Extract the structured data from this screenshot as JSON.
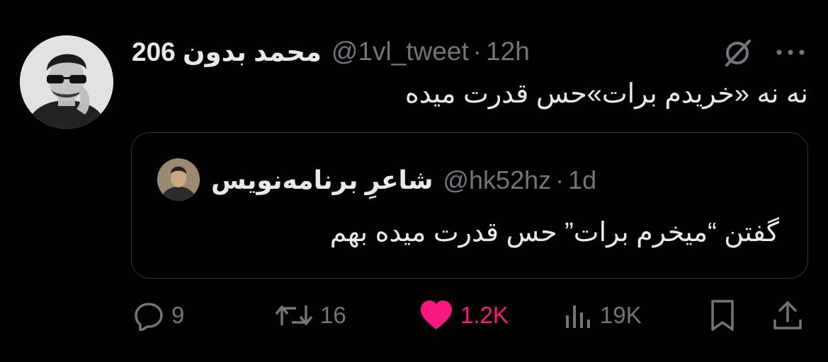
{
  "tweet": {
    "author_name": "محمد بدون 206",
    "handle": "@1vl_tweet",
    "separator": "·",
    "time": "12h",
    "text": "نه نه «خریدم برات»حس قدرت میده"
  },
  "quote": {
    "author_name": "شاعرِ برنامه‌نویس",
    "handle": "@hk52hz",
    "separator": "·",
    "time": "1d",
    "text": "گفتن “میخرم برات” حس قدرت میده بهم"
  },
  "actions": {
    "replies": "9",
    "retweets": "16",
    "likes": "1.2K",
    "views": "19K"
  },
  "colors": {
    "background": "#000000",
    "text": "#e7e9ea",
    "muted": "#71767b",
    "like": "#f91880",
    "border": "#2f3336"
  },
  "icons": [
    "grok-icon",
    "more-icon",
    "reply-icon",
    "retweet-icon",
    "heart-icon",
    "views-icon",
    "bookmark-icon",
    "share-icon"
  ]
}
